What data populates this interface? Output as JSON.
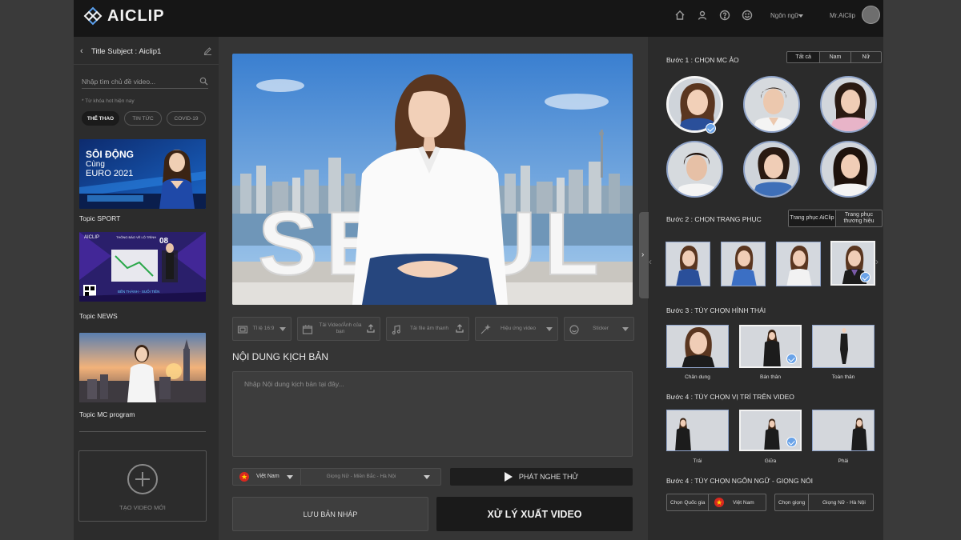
{
  "header": {
    "logo_text": "AICLIP",
    "icons": [
      "home-icon",
      "user-icon",
      "help-icon",
      "smiley-icon"
    ],
    "language_label": "Ngôn ngữ",
    "user_name": "Mr.AiClip"
  },
  "sidebar": {
    "title": "Title Subject : Aiclip1",
    "search_placeholder": "Nhập tìm chủ đề video...",
    "hot_keywords_label": "* Từ khóa hot hiện nay",
    "chips": [
      "THỂ THAO",
      "TIN TỨC",
      "COVID-19"
    ],
    "active_chip": "THỂ THAO",
    "topics": [
      {
        "label": "Topic SPORT",
        "thumb_title": "SÔI ĐỘNG",
        "thumb_sub1": "Cùng",
        "thumb_sub2": "EURO 2021"
      },
      {
        "label": "Topic NEWS",
        "thumb_logo": "AICLIP",
        "thumb_heading": "THÔNG BÁO VỀ LỘ TRÌNH",
        "thumb_num": "08",
        "thumb_route": "BẾN THÀNH - SUỐI TIÊN"
      },
      {
        "label": "Topic MC program"
      }
    ],
    "new_video_label": "TẠO VIDEO MỚI"
  },
  "editor": {
    "preview_sign": "SEOUL",
    "tools": [
      {
        "label": "Tỉ lệ 16:9",
        "icon": "aspect-ratio-icon",
        "control": "dropdown"
      },
      {
        "label": "Tải Video/Ảnh của bạn",
        "icon": "media-icon",
        "control": "upload"
      },
      {
        "label": "Tải file âm thanh",
        "icon": "music-icon",
        "control": "upload"
      },
      {
        "label": "Hiệu ứng video",
        "icon": "magic-wand-icon",
        "control": "dropdown"
      },
      {
        "label": "Sticker",
        "icon": "sticker-icon",
        "control": "dropdown"
      }
    ],
    "script_title": "NỘI DUNG KỊCH BẢN",
    "script_placeholder": "Nhập Nội dung kịch bản tại đây...",
    "country": "Việt Nam",
    "voice": "Giọng Nữ - Miền Bắc - Hà Nội",
    "play_label": "PHÁT NGHE THỬ",
    "draft_label": "LƯU BẢN NHÁP",
    "export_label": "XỬ LÝ XUẤT VIDEO"
  },
  "panel": {
    "step1": {
      "label": "Bước 1 : CHỌN MC ẢO",
      "filters": [
        "Tất cả",
        "Nam",
        "Nữ"
      ],
      "active_filter": "Tất cả",
      "mcs": [
        {
          "gender": "female",
          "selected": true
        },
        {
          "gender": "male",
          "selected": false
        },
        {
          "gender": "female",
          "selected": false
        },
        {
          "gender": "male",
          "selected": false
        },
        {
          "gender": "female",
          "selected": false
        },
        {
          "gender": "female",
          "selected": false
        }
      ]
    },
    "step2": {
      "label": "Bước 2 : CHỌN TRANG PHỤC",
      "tabs": [
        "Trang phục AiClip",
        "Trang phục thương hiệu"
      ],
      "active_tab": "Trang phục AiClip",
      "costume_colors": [
        "#2a4f9a",
        "#3b6fc4",
        "#f2f2f2",
        "#1c1c1c"
      ],
      "selected_costume": 3
    },
    "step3": {
      "label": "Bước 3 : TÙY CHỌN HÌNH THÁI",
      "options": [
        "Chân dung",
        "Bán thân",
        "Toàn thân"
      ],
      "selected": 1
    },
    "step4a": {
      "label": "Bước 4 : TÙY CHỌN VỊ TRÍ TRÊN VIDEO",
      "options": [
        "Trái",
        "Giữa",
        "Phải"
      ],
      "selected": 1
    },
    "step4b": {
      "label": "Bước 4 : TÙY CHỌN NGÔN NGỮ - GIỌNG NÓI",
      "country_label": "Chọn Quốc gia",
      "country_value": "Việt Nam",
      "voice_label": "Chọn giọng",
      "voice_value": "Giọng Nữ - Hà Nội"
    }
  },
  "colors": {
    "accent_check": "#6aa3e8",
    "border_blue": "#8fa3c8",
    "export_bg": "#1a1a1a"
  }
}
